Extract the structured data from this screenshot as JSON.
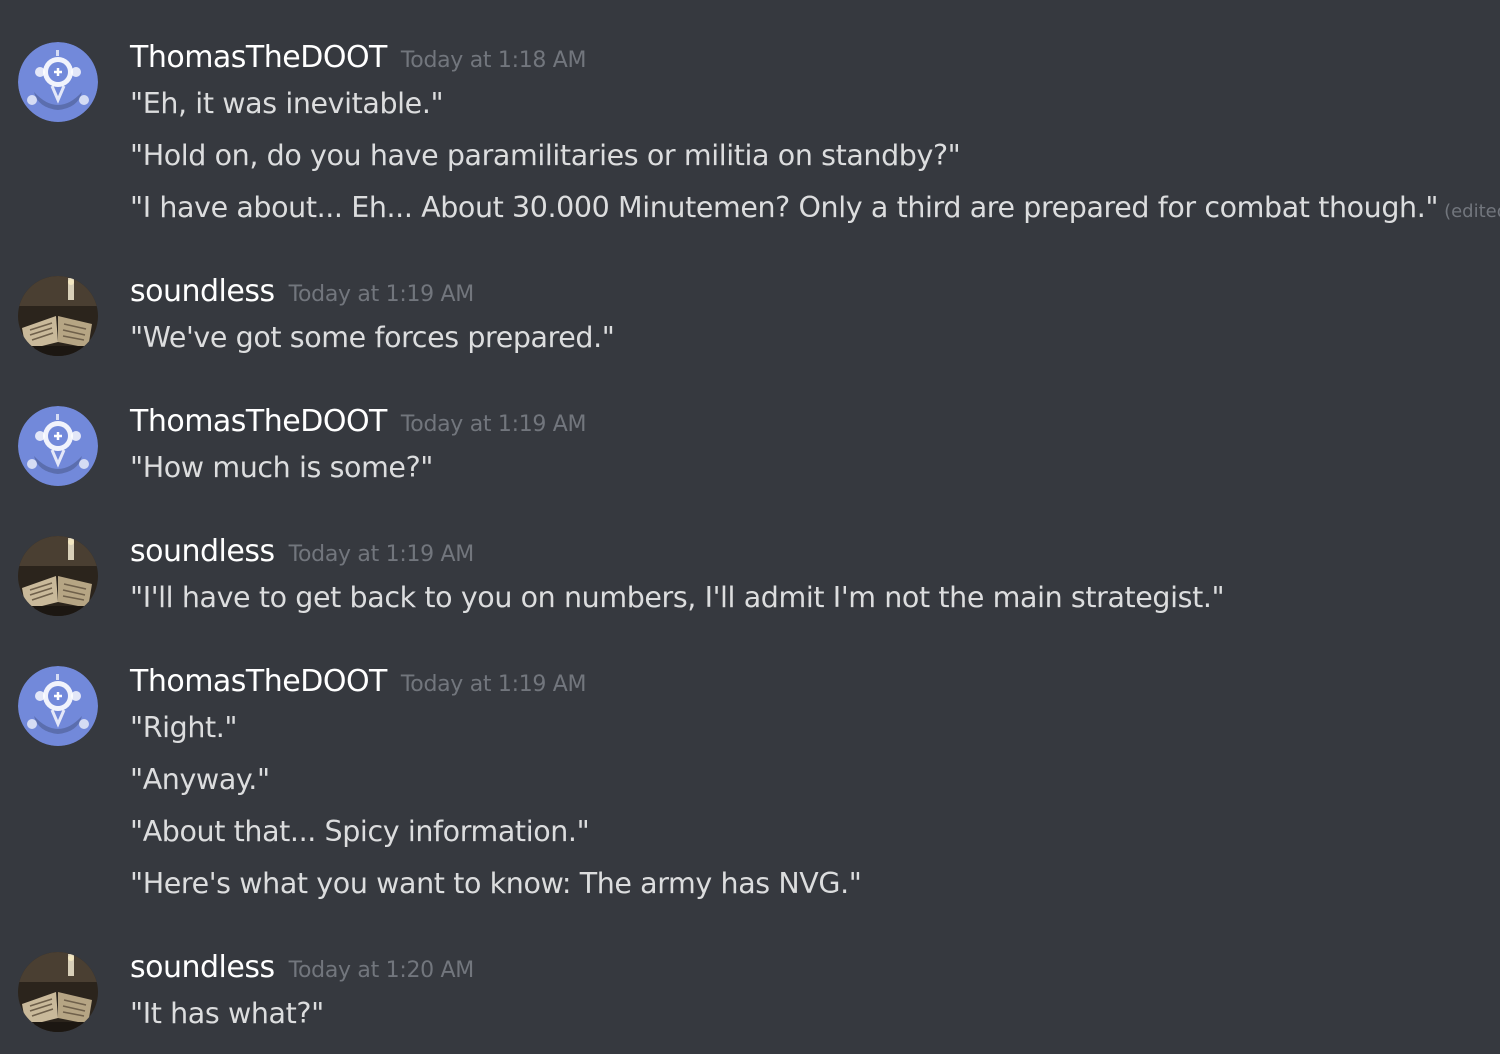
{
  "groups": [
    {
      "author": "ThomasTheDOOT",
      "avatar_icon": "robot-mask-avatar-icon",
      "timestamp": "Today at 1:18 AM",
      "messages": [
        {
          "text": "\"Eh, it was inevitable.\""
        },
        {
          "text": "\"Hold on, do you have paramilitaries or militia on standby?\""
        },
        {
          "text": "\"I have about... Eh... About 30.000 Minutemen? Only a third are prepared for combat though.\"",
          "edited": "(edited)"
        }
      ]
    },
    {
      "author": "soundless",
      "avatar_icon": "open-book-candle-avatar-icon",
      "timestamp": "Today at 1:19 AM",
      "messages": [
        {
          "text": "\"We've got some forces prepared.\""
        }
      ]
    },
    {
      "author": "ThomasTheDOOT",
      "avatar_icon": "robot-mask-avatar-icon",
      "timestamp": "Today at 1:19 AM",
      "messages": [
        {
          "text": "\"How much is some?\""
        }
      ]
    },
    {
      "author": "soundless",
      "avatar_icon": "open-book-candle-avatar-icon",
      "timestamp": "Today at 1:19 AM",
      "messages": [
        {
          "text": "\"I'll have to get back to you on numbers, I'll admit I'm not the main strategist.\""
        }
      ]
    },
    {
      "author": "ThomasTheDOOT",
      "avatar_icon": "robot-mask-avatar-icon",
      "timestamp": "Today at 1:19 AM",
      "messages": [
        {
          "text": "\"Right.\""
        },
        {
          "text": "\"Anyway.\""
        },
        {
          "text": "\"About that... Spicy information.\""
        },
        {
          "text": "\"Here's what you want to know: The army has NVG.\""
        }
      ]
    },
    {
      "author": "soundless",
      "avatar_icon": "open-book-candle-avatar-icon",
      "timestamp": "Today at 1:20 AM",
      "messages": [
        {
          "text": "\"It has what?\""
        }
      ]
    }
  ],
  "colors": {
    "background": "#36393f",
    "username": "#ffffff",
    "message_text": "#dcddde",
    "timestamp": "#72767d",
    "avatar_blurple": "#7289da"
  }
}
